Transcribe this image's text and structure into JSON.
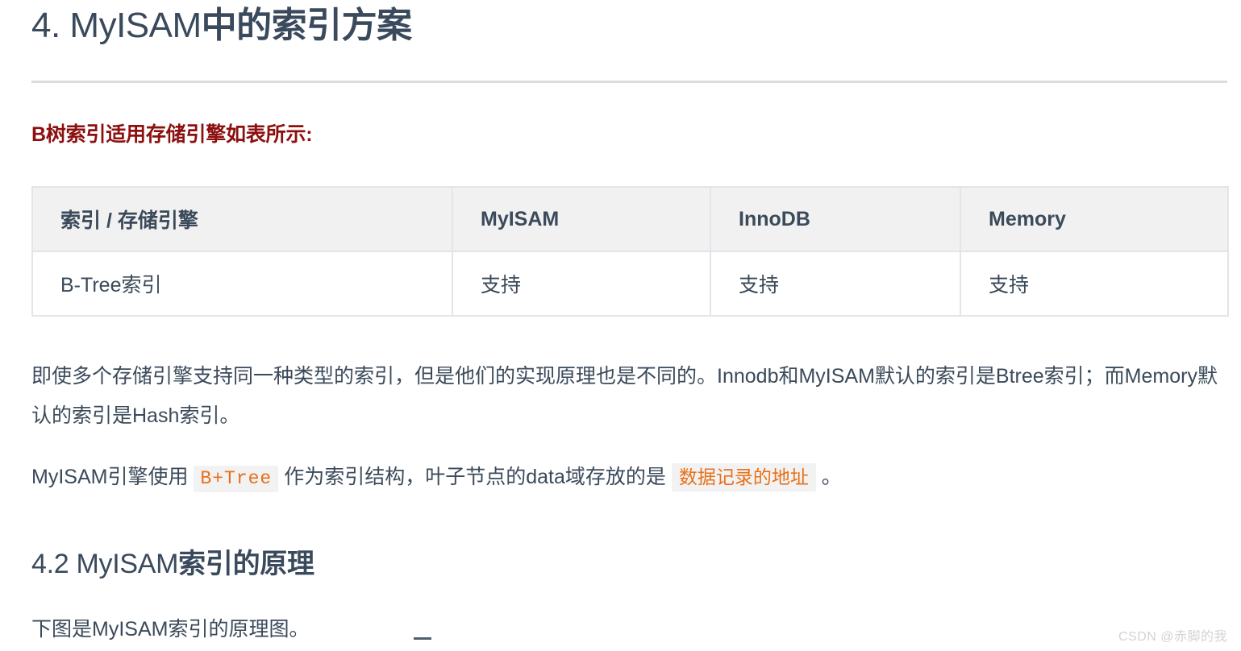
{
  "document": {
    "title_ascii": "4. MyISAM",
    "title_cjk": "中的索引方案",
    "title_full": "4. MyISAM中的索引方案",
    "subheading_red": "B树索引适用存储引擎如表所示:",
    "section_heading_ascii": "4.2 MyISAM",
    "section_heading_cjk": "索引的原理",
    "section_heading_full": "4.2 MyISAM索引的原理"
  },
  "table": {
    "headers": [
      "索引 / 存储引擎",
      "MyISAM",
      "InnoDB",
      "Memory"
    ],
    "rows": [
      {
        "index_type": "B-Tree索引",
        "myisam": "支持",
        "innodb": "支持",
        "memory": "支持"
      }
    ]
  },
  "paragraphs": {
    "p1": "即使多个存储引擎支持同一种类型的索引，但是他们的实现原理也是不同的。Innodb和MyISAM默认的索引是Btree索引；而Memory默认的索引是Hash索引。",
    "p2_part1": "MyISAM引擎使用",
    "p2_code1": "B+Tree",
    "p2_part2": "作为索引结构，叶子节点的data域存放的是",
    "p2_code2": "数据记录的地址",
    "p2_part3": "。",
    "p3": "下图是MyISAM索引的原理图。"
  },
  "watermark": {
    "text": "CSDN @赤脚的我"
  },
  "colors": {
    "heading": "#3a4a5c",
    "red_subheading": "#8c1010",
    "body_text": "#3b4a5a",
    "code_text": "#e8701a",
    "code_background": "#f2f2f2",
    "table_header_background": "#f1f1f1",
    "table_border": "#e2e5e9",
    "rule": "#dcdcdc",
    "watermark": "#d3d3d3"
  }
}
